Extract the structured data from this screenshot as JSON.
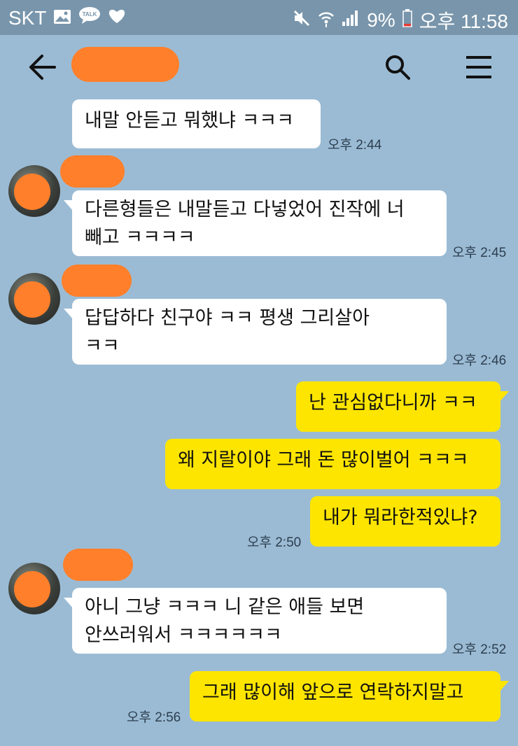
{
  "status_bar": {
    "carrier": "SKT",
    "battery": "9%",
    "time": "오후 11:58"
  },
  "header": {
    "back_icon": "arrow-left-icon",
    "search_icon": "search-icon",
    "menu_icon": "hamburger-menu-icon"
  },
  "messages": [
    {
      "side": "left",
      "lines": [
        "내말 안듣고 뭐했냐 ㅋㅋㅋ"
      ],
      "time": "오후 2:44"
    },
    {
      "side": "left",
      "lines": [
        "다른형들은 내말듣고 다넣었어 진작에 너",
        "빼고 ㅋㅋㅋㅋ"
      ],
      "time": "오후 2:45"
    },
    {
      "side": "left",
      "lines": [
        "답답하다 친구야  ㅋㅋ 평생 그리살아",
        "ㅋㅋ"
      ],
      "time": "오후 2:46"
    },
    {
      "side": "right",
      "lines": [
        "난 관심없다니까 ㅋㅋ"
      ],
      "time": ""
    },
    {
      "side": "right",
      "lines": [
        "왜 지랄이야 그래 돈 많이벌어 ㅋㅋㅋ"
      ],
      "time": ""
    },
    {
      "side": "right",
      "lines": [
        "내가 뭐라한적있냐?"
      ],
      "time": "오후 2:50"
    },
    {
      "side": "left",
      "lines": [
        "아니 그냥 ㅋㅋㅋ 니 같은 애들 보면",
        "안쓰러워서 ㅋㅋㅋㅋㅋㅋ"
      ],
      "time": "오후 2:52"
    },
    {
      "side": "right",
      "lines": [
        "그래 많이해 앞으로 연락하지말고"
      ],
      "time": "오후 2:56"
    }
  ],
  "colors": {
    "background": "#9bbbd4",
    "status_bar": "#7895ab",
    "my_bubble": "#fee500",
    "their_bubble": "#ffffff",
    "redaction": "#ff7f2a"
  }
}
